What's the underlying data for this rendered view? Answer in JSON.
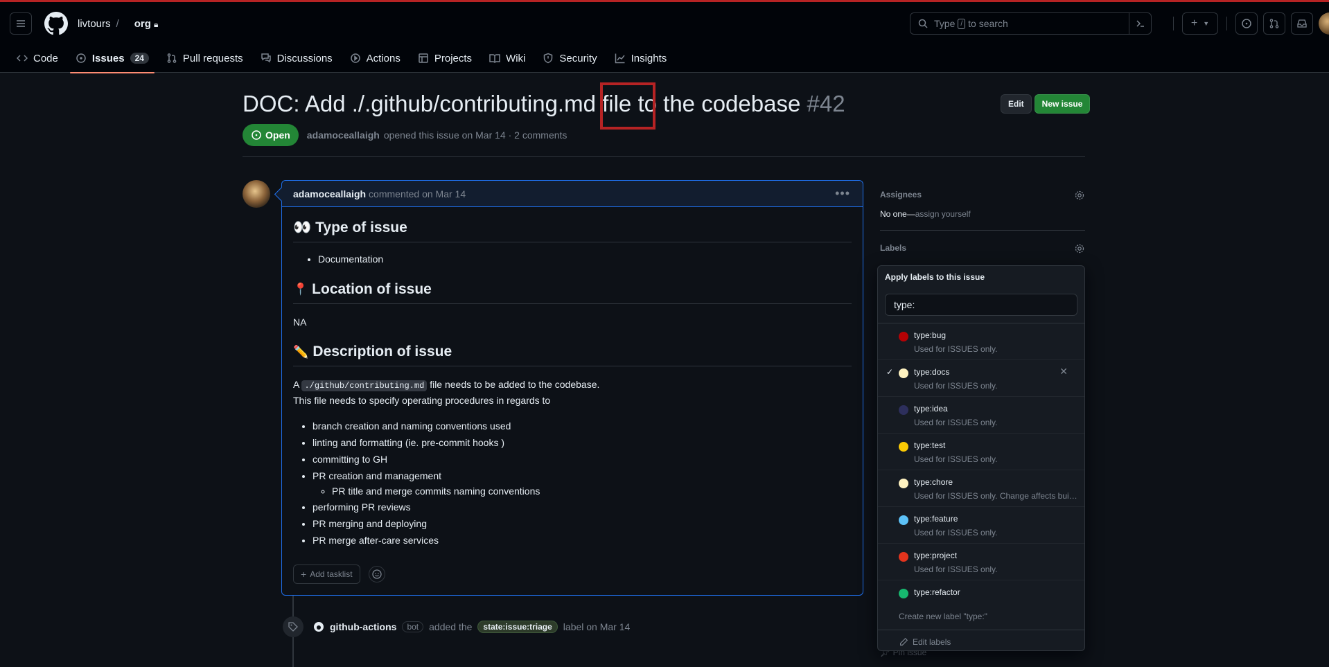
{
  "repo": {
    "owner": "livtours",
    "name": "org"
  },
  "search": {
    "prefix": "Type",
    "key": "/",
    "suffix": "to search"
  },
  "tabs": [
    {
      "label": "Code"
    },
    {
      "label": "Issues",
      "count": "24"
    },
    {
      "label": "Pull requests"
    },
    {
      "label": "Discussions"
    },
    {
      "label": "Actions"
    },
    {
      "label": "Projects"
    },
    {
      "label": "Wiki"
    },
    {
      "label": "Security"
    },
    {
      "label": "Insights"
    }
  ],
  "issue": {
    "title": "DOC: Add ./.github/contributing.md file to the codebase",
    "number": "#42",
    "edit_label": "Edit",
    "new_label": "New issue",
    "state": "Open",
    "author": "adamoceallaigh",
    "meta_text": "opened this issue on Mar 14 · 2 comments"
  },
  "comment": {
    "author": "adamoceallaigh",
    "when": "commented on Mar 14",
    "h_type": "Type of issue",
    "h_type_emoji": "👀",
    "type_item": "Documentation",
    "h_loc": "Location of issue",
    "h_loc_emoji": "📍",
    "loc_text": "NA",
    "h_desc": "Description of issue",
    "h_desc_emoji": "✏️",
    "desc_a": "A",
    "desc_code": "./github/contributing.md",
    "desc_b": "file needs to be added to the codebase.",
    "desc_line2": "This file needs to specify operating procedures in regards to",
    "items": [
      "branch creation and naming conventions used",
      "linting and formatting (ie. pre-commit hooks )",
      "committing to GH",
      "PR creation and management",
      "performing PR reviews",
      "PR merging and deploying",
      "PR merge after-care services"
    ],
    "subitem": "PR title and merge commits naming conventions",
    "add_tasklist": "Add tasklist"
  },
  "event": {
    "actor": "github-actions",
    "badge": "bot",
    "text1": "added the",
    "label": "state:issue:triage",
    "text2": "label on Mar 14"
  },
  "sidebar": {
    "assignees_title": "Assignees",
    "assignees_none": "No one—",
    "assignees_link": "assign yourself",
    "labels_title": "Labels",
    "pin": "Pin issue"
  },
  "popover": {
    "title": "Apply labels to this issue",
    "filter": "type:",
    "labels": [
      {
        "name": "type:bug",
        "desc": "Used for ISSUES only.",
        "color": "#b60205",
        "checked": false
      },
      {
        "name": "type:docs",
        "desc": "Used for ISSUES only.",
        "color": "#fef2c0",
        "checked": true
      },
      {
        "name": "type:idea",
        "desc": "Used for ISSUES only.",
        "color": "#2d2f5c",
        "checked": false
      },
      {
        "name": "type:test",
        "desc": "Used for ISSUES only.",
        "color": "#fbca04",
        "checked": false
      },
      {
        "name": "type:chore",
        "desc": "Used for ISSUES only. Change affects build ...",
        "color": "#fef2c0",
        "checked": false
      },
      {
        "name": "type:feature",
        "desc": "Used for ISSUES only.",
        "color": "#5cc1f7",
        "checked": false
      },
      {
        "name": "type:project",
        "desc": "Used for ISSUES only.",
        "color": "#e4341d",
        "checked": false
      },
      {
        "name": "type:refactor",
        "desc": "",
        "color": "#17b86f",
        "checked": false
      }
    ],
    "create": "Create new label \"type:\"",
    "edit": "Edit labels"
  }
}
